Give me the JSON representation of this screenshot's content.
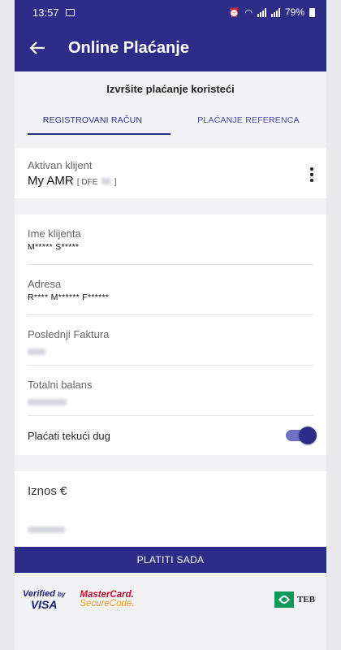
{
  "status_bar": {
    "time": "13:57",
    "battery": "79%"
  },
  "app_bar": {
    "title": "Online Plaćanje"
  },
  "subtitle": "Izvršite plaćanje koristeći",
  "tabs": [
    {
      "label": "REGISTROVANI RAČUN",
      "active": true
    },
    {
      "label": "PLAĆANJE REFERENCA",
      "active": false
    }
  ],
  "client": {
    "label": "Aktivan klijent",
    "name": "My AMR",
    "code_prefix": "[ DFE",
    "code_suffix": "]"
  },
  "details": {
    "client_name_label": "Ime klijenta",
    "client_name_value": "M***** S*****",
    "address_label": "Adresa",
    "address_value": "R**** M****** F******",
    "last_invoice_label": "Poslednji Faktura",
    "balance_label": "Totalni balans",
    "pay_current_label": "Plaćati tekući dug",
    "pay_current_enabled": true
  },
  "amount": {
    "label": "Iznos €"
  },
  "pay_button": {
    "label": "PLATITI SADA"
  },
  "brands": {
    "visa_top": "Verified",
    "visa_by": "by",
    "visa_bottom": "VISA",
    "mc_top": "MasterCard.",
    "mc_bottom": "SecureCode.",
    "teb": "TEB"
  },
  "colors": {
    "primary": "#2d2d89",
    "toggle_track": "#6f6fc6"
  }
}
